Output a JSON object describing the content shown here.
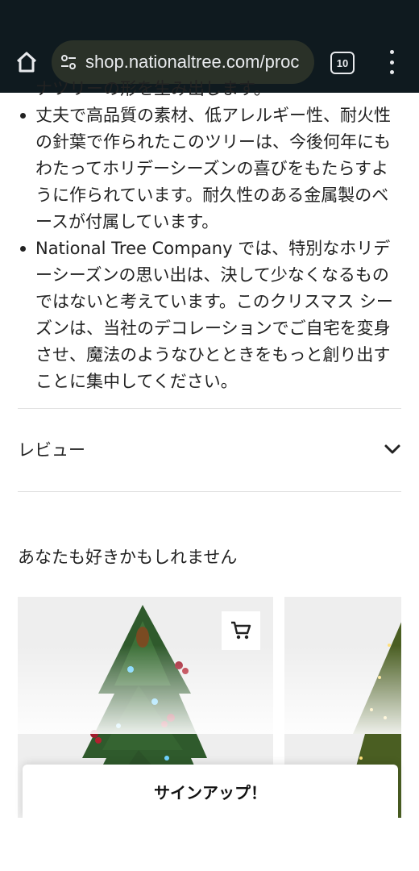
{
  "browser": {
    "url": "shop.nationaltree.com/proc",
    "tab_count": "10"
  },
  "description": {
    "clipped_line": "ナツリーの形を生み出します。",
    "bullets": [
      "丈夫で高品質の素材、低アレルギー性、耐火性の針葉で作られたこのツリーは、今後何年にもわたってホリデーシーズンの喜びをもたらすように作られています。耐久性のある金属製のベースが付属しています。",
      "National Tree Company では、特別なホリデーシーズンの思い出は、決して少なくなるものではないと考えています。このクリスマス シーズンは、当社のデコレーションでご自宅を変身させ、魔法のようなひとときをもっと創り出すことに集中してください。"
    ]
  },
  "reviews": {
    "label": "レビュー"
  },
  "recommendations": {
    "title": "あなたも好きかもしれません"
  },
  "signup": {
    "label": "サインアップ！"
  },
  "icons": [
    "home-icon",
    "site-settings-icon",
    "tab-switcher-icon",
    "more-menu-icon",
    "chevron-down-icon",
    "cart-icon"
  ],
  "colors": {
    "chrome": "#0f1a1f",
    "urlbar": "#2a3128",
    "card_bg": "#eeeeee"
  }
}
